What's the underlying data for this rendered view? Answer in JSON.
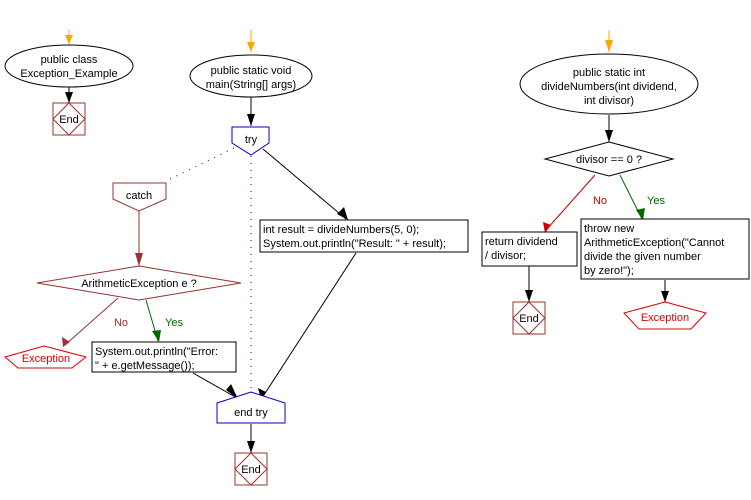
{
  "colors": {
    "entry_arrow": "#FFA500",
    "flow": "#000000",
    "try_block": "#0000CC",
    "catch_block": "#993333",
    "end_block": "#993333",
    "exception": "#DD0000",
    "yes": "#006600",
    "no": "#CC0000",
    "no_catch": "#993333"
  },
  "flowcharts": [
    {
      "name": "class",
      "start": {
        "lines": [
          "public class",
          "Exception_Example"
        ]
      },
      "end": {
        "label": "End"
      }
    },
    {
      "name": "main",
      "start": {
        "lines": [
          "public static void",
          "main(String[] args)"
        ]
      },
      "try": {
        "label": "try"
      },
      "catch": {
        "label": "catch"
      },
      "decision": {
        "label": "ArithmeticException e ?",
        "no": "No",
        "yes": "Yes"
      },
      "exception": {
        "label": "Exception"
      },
      "catch_action": {
        "lines": [
          "System.out.println(\"Error:",
          "\" + e.getMessage());"
        ]
      },
      "try_action": {
        "lines": [
          "int result = divideNumbers(5, 0);",
          "System.out.println(\"Result: \" + result);"
        ]
      },
      "end_try": {
        "label": "end try"
      },
      "end": {
        "label": "End"
      }
    },
    {
      "name": "divideNumbers",
      "start": {
        "lines": [
          "public static int",
          "divideNumbers(int dividend,",
          "int divisor)"
        ]
      },
      "decision": {
        "label": "divisor == 0 ?",
        "no": "No",
        "yes": "Yes"
      },
      "return_action": {
        "lines": [
          "return dividend",
          "/ divisor;"
        ]
      },
      "throw_action": {
        "lines": [
          "throw new",
          "ArithmeticException(\"Cannot",
          "divide the given number",
          "by zero!\");"
        ]
      },
      "end": {
        "label": "End"
      },
      "exception": {
        "label": "Exception"
      }
    }
  ]
}
